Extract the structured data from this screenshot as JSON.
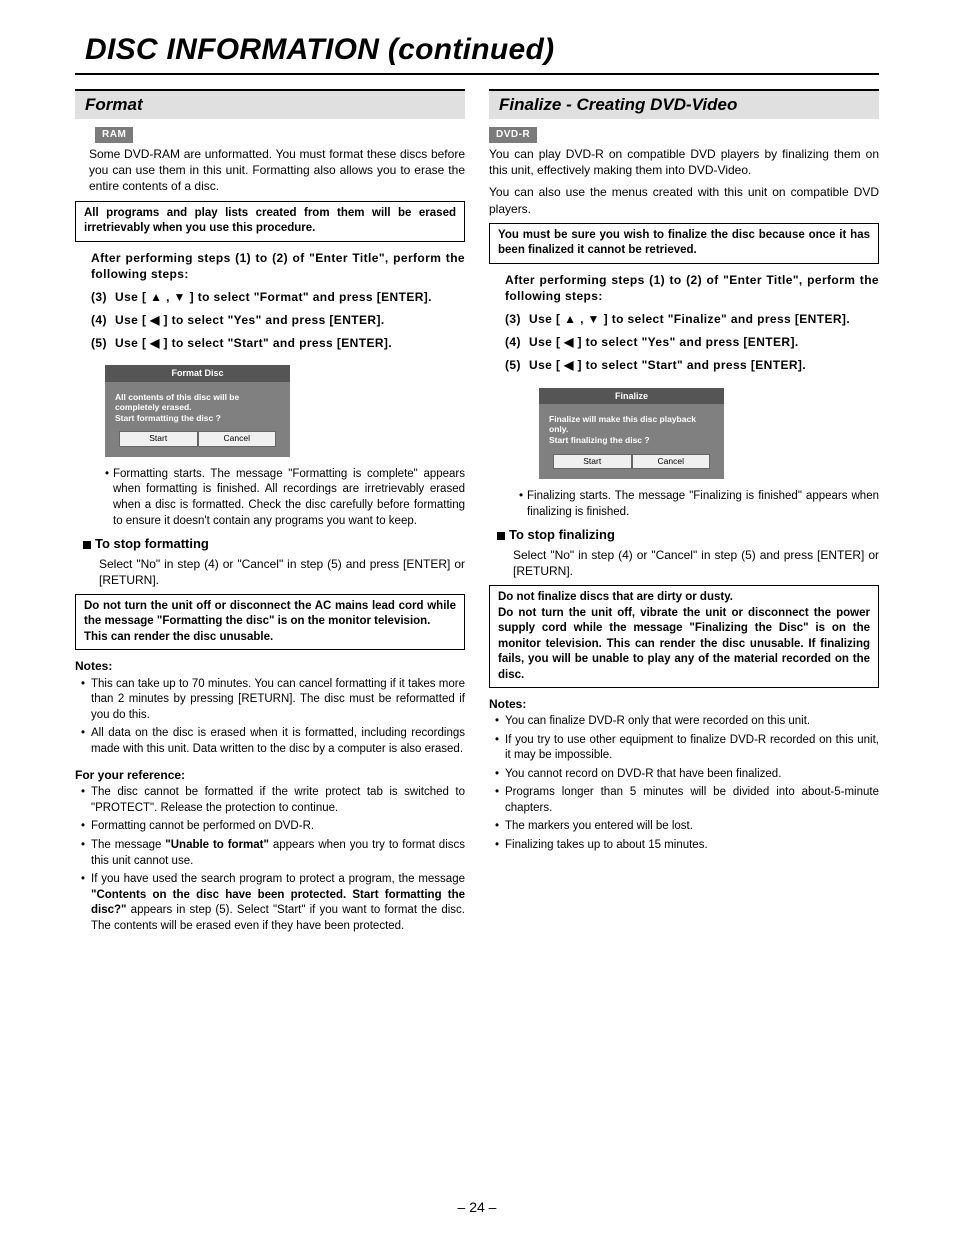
{
  "page": {
    "title": "DISC INFORMATION (continued)",
    "number": "– 24 –"
  },
  "left": {
    "heading": "Format",
    "badge": "RAM",
    "intro": "Some DVD-RAM are unformatted. You must format these discs before you can use them in this unit. Formatting also allows you to erase the entire contents of a disc.",
    "warn1": "All programs and play lists created from them will be erased irretrievably when you use this procedure.",
    "steps_intro": "After performing steps (1) to (2) of \"Enter Title\", perform the following steps:",
    "step3_num": "(3)",
    "step3": "Use [ ▲ ,  ▼ ] to select \"Format\" and press [ENTER].",
    "step4_num": "(4)",
    "step4": "Use [ ◀ ] to select \"Yes\" and press [ENTER].",
    "step5_num": "(5)",
    "step5": "Use [ ◀ ] to select \"Start\" and press [ENTER].",
    "dialog": {
      "title": "Format Disc",
      "body": "All contents of this disc will be completely erased.\nStart formatting the disc ?",
      "btn_start": "Start",
      "btn_cancel": "Cancel"
    },
    "post_dialog": "Formatting starts. The message \"Formatting is complete\" appears when formatting is finished. All recordings are irretrievably erased when a disc is formatted. Check the disc carefully before formatting to ensure it doesn't contain any programs you want to keep.",
    "stop_heading": "To stop formatting",
    "stop_body": "Select \"No\" in step (4) or \"Cancel\" in step (5) and press [ENTER] or [RETURN].",
    "warn2_a": "Do not turn the unit off or disconnect the AC mains lead cord while the message \"Formatting the disc\" is on the monitor television.",
    "warn2_b": "This can render the disc unusable.",
    "notes_head": "Notes:",
    "notes": [
      "This can take up to 70 minutes. You can cancel formatting if it takes more than 2 minutes by pressing [RETURN]. The disc must be reformatted if you do this.",
      "All data on the disc is erased when it is formatted, including recordings made with this unit. Data written to the disc by a computer is also erased."
    ],
    "ref_head": "For your reference:",
    "ref": [
      {
        "pre": "The disc cannot be formatted if the write protect tab is switched to \"PROTECT\". Release the protection to continue."
      },
      {
        "pre": "Formatting cannot be performed on DVD-R."
      },
      {
        "pre": "The message ",
        "bold": "\"Unable to format\"",
        "post": " appears when you try to format discs this unit cannot use."
      },
      {
        "pre": "If you have used the search program to protect a program, the message ",
        "bold": "\"Contents on the disc have been protected. Start formatting the disc?\"",
        "post": " appears in step (5). Select \"Start\" if you want to format the disc. The contents will be erased even if they have been protected."
      }
    ]
  },
  "right": {
    "heading": "Finalize - Creating DVD-Video",
    "badge": "DVD-R",
    "intro1": "You can play DVD-R on compatible DVD players by finalizing them on this unit, effectively making them into DVD-Video.",
    "intro2": "You can also use the menus created with this unit on compatible DVD players.",
    "warn1": "You must be sure you wish to finalize the disc because once it has been finalized it cannot be retrieved.",
    "steps_intro": "After performing steps (1) to (2) of \"Enter Title\", perform the following steps:",
    "step3_num": "(3)",
    "step3": "Use [ ▲ ,  ▼ ] to select \"Finalize\" and press [ENTER].",
    "step4_num": "(4)",
    "step4": "Use [ ◀ ] to select \"Yes\" and press [ENTER].",
    "step5_num": "(5)",
    "step5": "Use [ ◀ ] to select \"Start\" and press [ENTER].",
    "dialog": {
      "title": "Finalize",
      "body": "Finalize will make this disc playback only.\nStart finalizing the disc ?",
      "btn_start": "Start",
      "btn_cancel": "Cancel"
    },
    "post_dialog": "Finalizing starts. The message \"Finalizing is finished\" appears when finalizing is finished.",
    "stop_heading": "To stop finalizing",
    "stop_body": "Select \"No\" in step (4) or \"Cancel\" in step (5) and press [ENTER] or [RETURN].",
    "warn2_a": "Do not finalize discs that are dirty or dusty.",
    "warn2_b": "Do not turn the unit off, vibrate the unit or disconnect the power supply cord while the message \"Finalizing the Disc\" is on the monitor television. This can render the disc unusable. If finalizing fails, you will be unable to play any of the material recorded on the disc.",
    "notes_head": "Notes:",
    "notes": [
      "You can finalize DVD-R only that were recorded on this unit.",
      "If you try to use other equipment to finalize DVD-R recorded on this unit, it may be impossible.",
      "You cannot record on DVD-R that have been finalized.",
      "Programs longer than 5 minutes will be divided into about-5-minute chapters.",
      "The markers you entered will be lost.",
      "Finalizing takes up to about 15 minutes."
    ]
  }
}
